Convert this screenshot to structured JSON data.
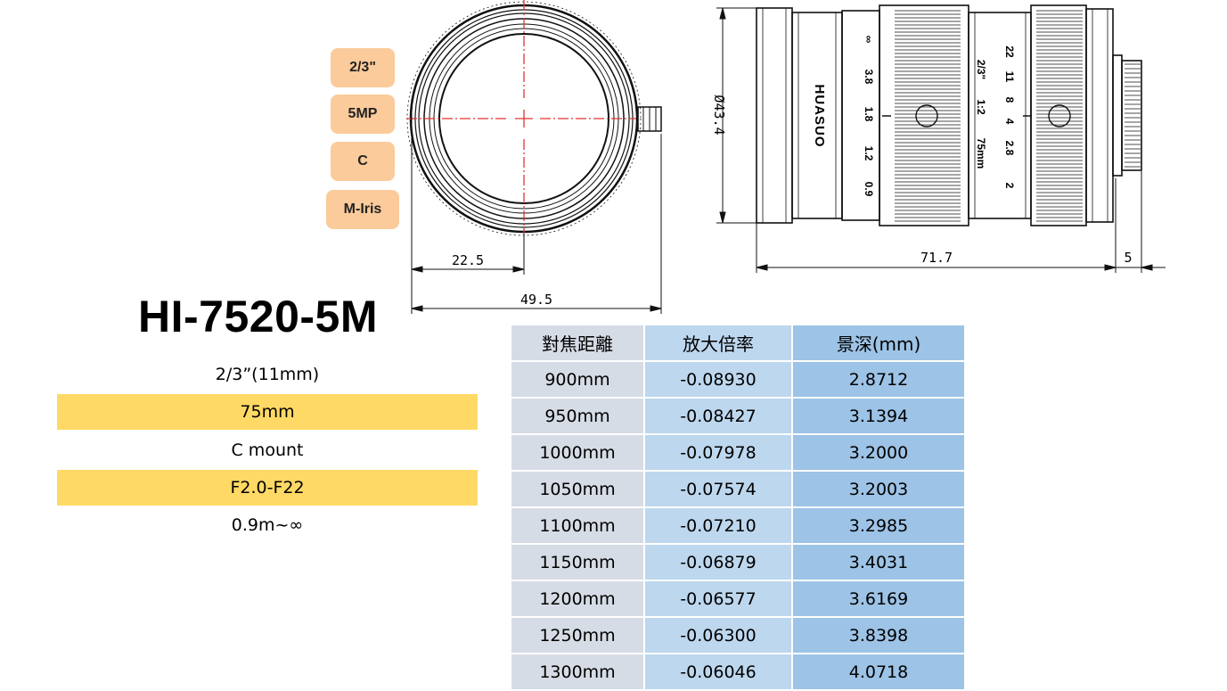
{
  "tags": [
    "2/3\"",
    "5MP",
    "C",
    "M-Iris"
  ],
  "model": "HI-7520-5M",
  "specs": [
    "2/3”(11mm)",
    "75mm",
    "C mount",
    "F2.0-F22",
    "0.9m~∞"
  ],
  "front_view": {
    "dim_radius": "22.5",
    "dim_width": "49.5"
  },
  "side_view": {
    "brand": "HUASUO",
    "diameter": "Ø43.4",
    "length": "71.7",
    "flange": "5",
    "focus_scale": [
      "∞",
      "3.8",
      "1.8",
      "1.2",
      "0.9"
    ],
    "focal_length": "75mm",
    "ratio": "1:2",
    "sensor": "2/3\"",
    "aperture_scale": [
      "2",
      "2.8",
      "4",
      "8",
      "11",
      "22"
    ]
  },
  "table": {
    "headers": [
      "對焦距離",
      "放大倍率",
      "景深(mm)"
    ],
    "rows": [
      [
        "900mm",
        "-0.08930",
        "2.8712"
      ],
      [
        "950mm",
        "-0.08427",
        "3.1394"
      ],
      [
        "1000mm",
        "-0.07978",
        "3.2000"
      ],
      [
        "1050mm",
        "-0.07574",
        "3.2003"
      ],
      [
        "1100mm",
        "-0.07210",
        "3.2985"
      ],
      [
        "1150mm",
        "-0.06879",
        "3.4031"
      ],
      [
        "1200mm",
        "-0.06577",
        "3.6169"
      ],
      [
        "1250mm",
        "-0.06300",
        "3.8398"
      ],
      [
        "1300mm",
        "-0.06046",
        "4.0718"
      ]
    ]
  }
}
